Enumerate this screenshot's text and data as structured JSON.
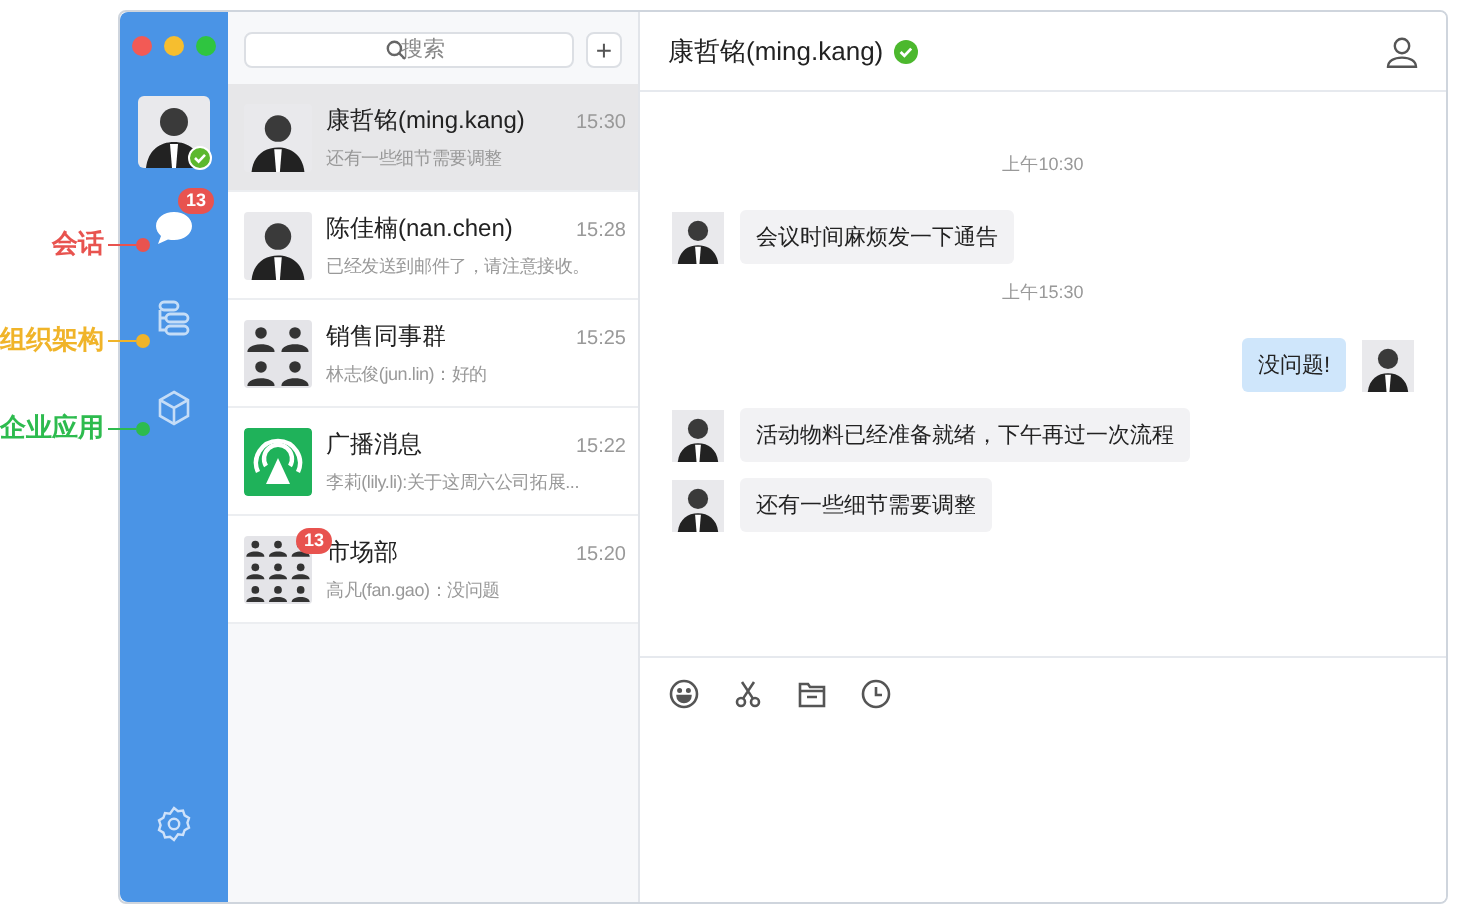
{
  "annotations": [
    {
      "label": "会话",
      "color": "#e8534f"
    },
    {
      "label": "组织架构",
      "color": "#f0b429"
    },
    {
      "label": "企业应用",
      "color": "#2dbb4e"
    }
  ],
  "sidebar": {
    "online": true,
    "nav": [
      {
        "kind": "chat",
        "badge": "13",
        "selected": true
      },
      {
        "kind": "org",
        "selected": false
      },
      {
        "kind": "apps",
        "selected": false
      }
    ]
  },
  "search": {
    "placeholder": "搜索",
    "add_button": "+"
  },
  "conversations": [
    {
      "kind": "person",
      "name": "康哲铭(ming.kang)",
      "time": "15:30",
      "preview": "还有一些细节需要调整",
      "selected": true
    },
    {
      "kind": "person",
      "name": "陈佳楠(nan.chen)",
      "time": "15:28",
      "preview": "已经发送到邮件了，请注意接收。",
      "selected": false
    },
    {
      "kind": "group4",
      "name": "销售同事群",
      "time": "15:25",
      "preview": "林志俊(jun.lin)：好的",
      "selected": false
    },
    {
      "kind": "broadcast",
      "name": "广播消息",
      "time": "15:22",
      "preview": "李莉(lily.li):关于这周六公司拓展...",
      "selected": false
    },
    {
      "kind": "group9",
      "name": "市场部",
      "time": "15:20",
      "preview": "高凡(fan.gao)：没问题",
      "selected": false,
      "badge": "13"
    }
  ],
  "chat": {
    "title": "康哲铭(ming.kang)",
    "verified": true,
    "messages": [
      {
        "kind": "time",
        "text": "上午10:30"
      },
      {
        "kind": "incoming",
        "text": "会议时间麻烦发一下通告"
      },
      {
        "kind": "time",
        "text": "上午15:30"
      },
      {
        "kind": "outgoing",
        "text": "没问题!"
      },
      {
        "kind": "incoming",
        "text": "活动物料已经准备就绪，下午再过一次流程"
      },
      {
        "kind": "incoming",
        "text": "还有一些细节需要调整"
      }
    ]
  }
}
